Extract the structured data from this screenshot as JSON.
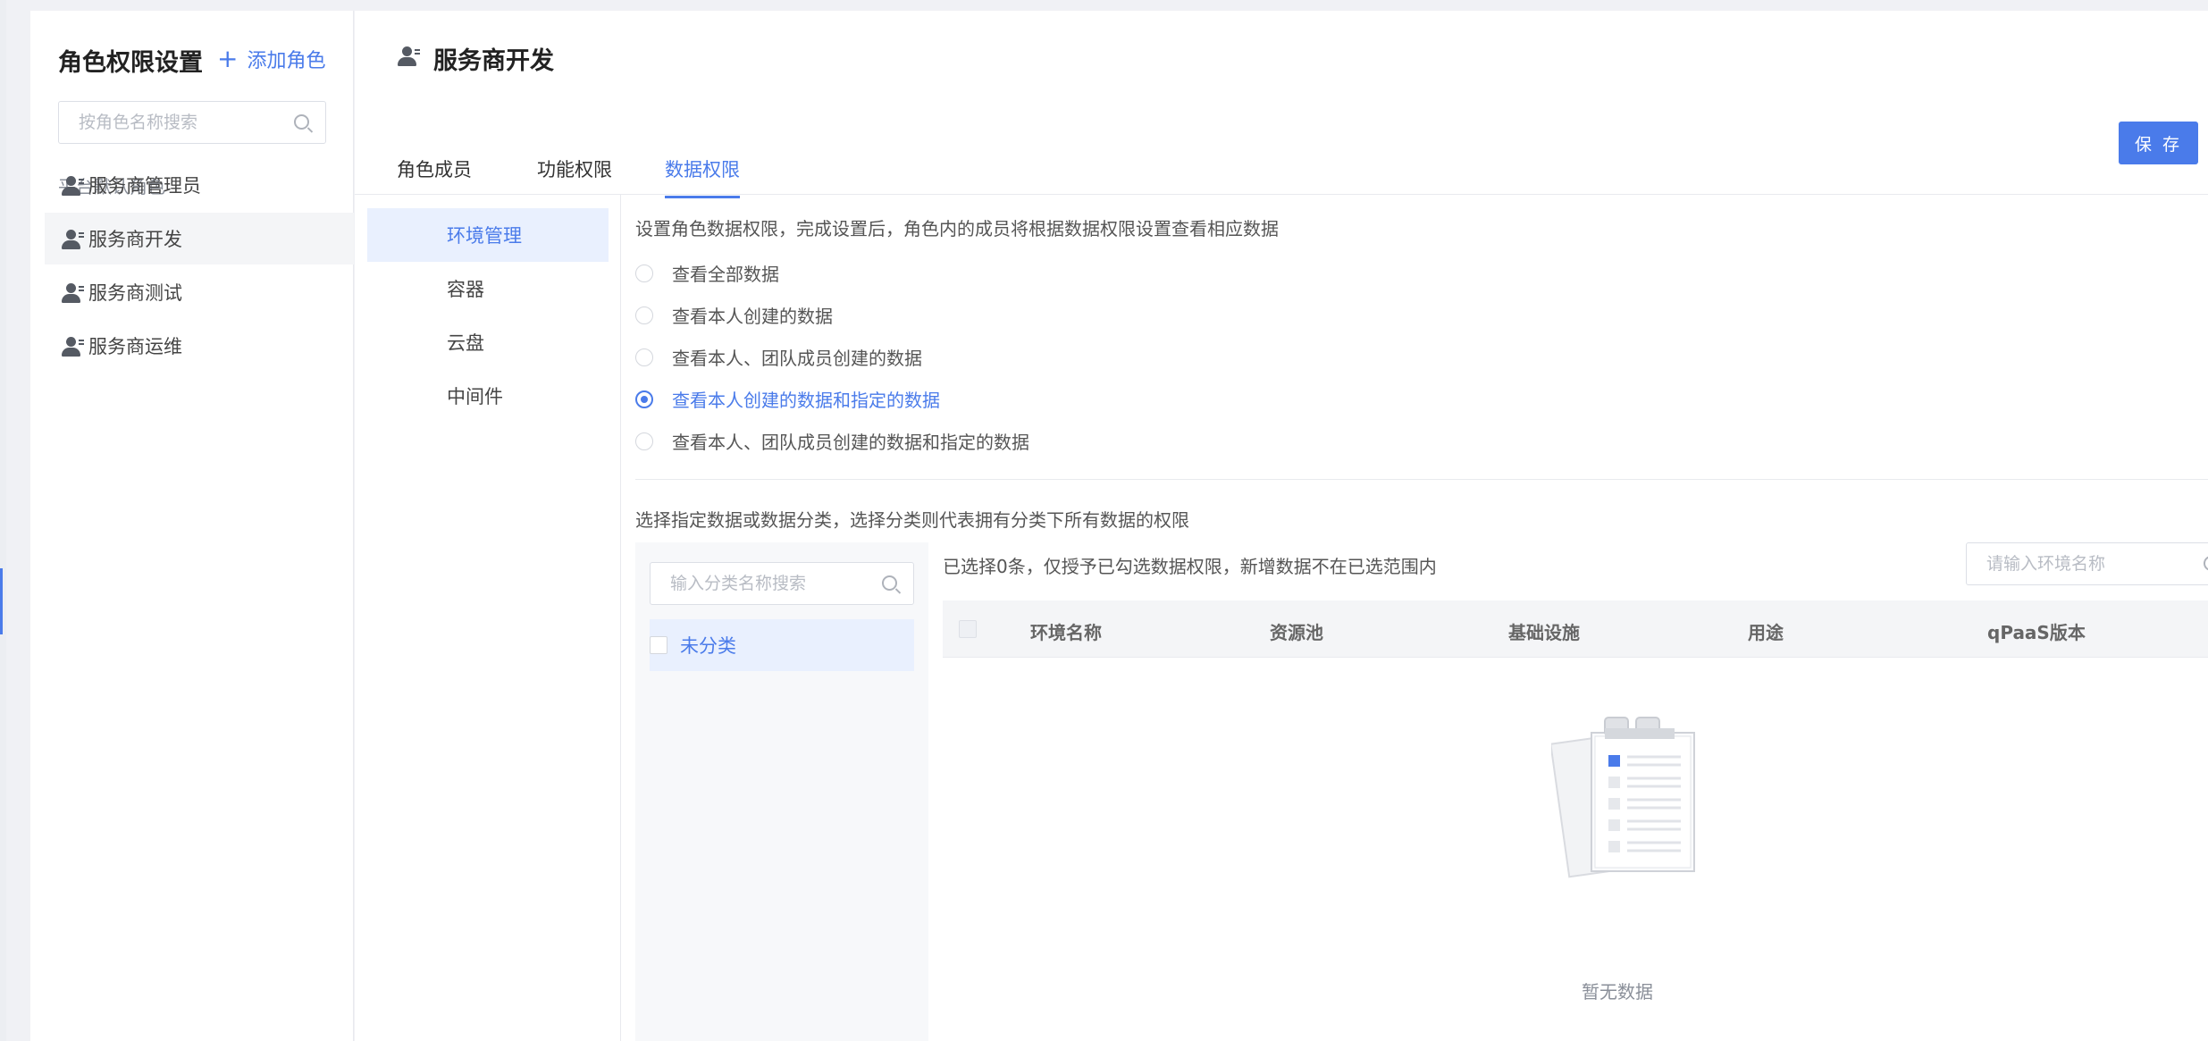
{
  "sidebar": {
    "title": "角色权限设置",
    "add_label": "添加角色",
    "search_placeholder": "按角色名称搜索",
    "group_label": "平台默认角色",
    "items": [
      {
        "label": "服务商管理员"
      },
      {
        "label": "服务商开发"
      },
      {
        "label": "服务商测试"
      },
      {
        "label": "服务商运维"
      }
    ],
    "active_item": "服务商开发"
  },
  "header": {
    "title": "服务商开发",
    "save_label": "保 存"
  },
  "tabs": [
    {
      "label": "角色成员"
    },
    {
      "label": "功能权限"
    },
    {
      "label": "数据权限"
    }
  ],
  "active_tab": "数据权限",
  "subnav": {
    "items": [
      {
        "label": "环境管理"
      },
      {
        "label": "容器"
      },
      {
        "label": "云盘"
      },
      {
        "label": "中间件"
      }
    ],
    "active_item": "环境管理"
  },
  "data_permission": {
    "description": "设置角色数据权限，完成设置后，角色内的成员将根据数据权限设置查看相应数据",
    "options": [
      {
        "label": "查看全部数据"
      },
      {
        "label": "查看本人创建的数据"
      },
      {
        "label": "查看本人、团队成员创建的数据"
      },
      {
        "label": "查看本人创建的数据和指定的数据"
      },
      {
        "label": "查看本人、团队成员创建的数据和指定的数据"
      }
    ],
    "selected_option": "查看本人创建的数据和指定的数据",
    "assign_description": "选择指定数据或数据分类，选择分类则代表拥有分类下所有数据的权限"
  },
  "category_panel": {
    "search_placeholder": "输入分类名称搜索",
    "items": [
      {
        "label": "未分类"
      }
    ]
  },
  "data_table": {
    "selection_info": "已选择0条，仅授予已勾选数据权限，新增数据不在已选范围内",
    "search_placeholder": "请输入环境名称",
    "columns": [
      "环境名称",
      "资源池",
      "基础设施",
      "用途",
      "qPaaS版本"
    ],
    "rows": [],
    "empty_text": "暂无数据"
  },
  "colors": {
    "accent": "#4a7bea",
    "active_bg": "#e9f0fe",
    "page_bg": "#f0f1f5"
  },
  "icons": {
    "role": "user-role-icon",
    "search": "search-icon",
    "add": "plus-icon",
    "empty": "clipboard-empty-icon"
  }
}
